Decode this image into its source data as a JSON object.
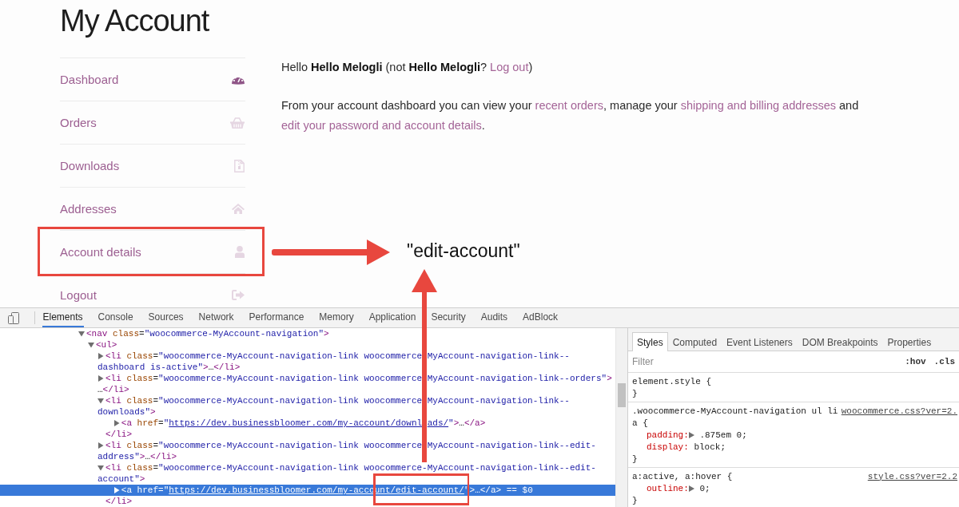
{
  "page": {
    "title": "My Account"
  },
  "nav": [
    {
      "label": "Dashboard",
      "selected": true
    },
    {
      "label": "Orders",
      "selected": false
    },
    {
      "label": "Downloads",
      "selected": false
    },
    {
      "label": "Addresses",
      "selected": false
    },
    {
      "label": "Account details",
      "selected": false
    },
    {
      "label": "Logout",
      "selected": false
    }
  ],
  "greeting": [
    {
      "kind": "text",
      "text": "Hello **Hello Melogli** (not **Hello Melogli**? "
    },
    {
      "kind": "link",
      "text": "Log out"
    },
    {
      "kind": "text",
      "text": ")"
    }
  ],
  "intro": [
    {
      "kind": "text",
      "text": "From your account dashboard you can view your "
    },
    {
      "kind": "link",
      "text": "recent orders"
    },
    {
      "kind": "text",
      "text": ", manage your "
    },
    {
      "kind": "link",
      "text": "shipping and billing addresses"
    },
    {
      "kind": "text",
      "text": " and "
    },
    {
      "kind": "link",
      "text": "edit your password and account details"
    },
    {
      "kind": "text",
      "text": "."
    }
  ],
  "annotation": {
    "label": "\"edit-account\""
  },
  "devtools": {
    "tabs": [
      {
        "label": "Elements",
        "selected": true
      },
      {
        "label": "Console",
        "selected": false
      },
      {
        "label": "Sources",
        "selected": false
      },
      {
        "label": "Network",
        "selected": false
      },
      {
        "label": "Performance",
        "selected": false
      },
      {
        "label": "Memory",
        "selected": false
      },
      {
        "label": "Application",
        "selected": false
      },
      {
        "label": "Security",
        "selected": false
      },
      {
        "label": "Audits",
        "selected": false
      },
      {
        "label": "AdBlock",
        "selected": false
      }
    ],
    "dom": {
      "expanded": true,
      "selected": false,
      "lines": [
        [
          {
            "kind": "tag",
            "text": "<nav"
          },
          {
            "kind": "attr",
            "text": " class"
          },
          {
            "kind": "text",
            "text": "="
          },
          {
            "kind": "value",
            "text": "\"woocommerce-MyAccount-navigation\""
          },
          {
            "kind": "tag",
            "text": ">"
          }
        ]
      ],
      "children": [
        {
          "expanded": true,
          "selected": false,
          "lines": [
            [
              {
                "kind": "tag",
                "text": "<ul>"
              }
            ]
          ],
          "children": [
            {
              "expanded": false,
              "selected": false,
              "lines": [
                [
                  {
                    "kind": "tag",
                    "text": "<li"
                  },
                  {
                    "kind": "attr",
                    "text": " class"
                  },
                  {
                    "kind": "text",
                    "text": "="
                  },
                  {
                    "kind": "value",
                    "text": "\"woocommerce-MyAccount-navigation-link woocommerce"
                  },
                  {
                    "kind": "covered"
                  },
                  {
                    "kind": "value",
                    "text": "MyAccount-navigation-link--"
                  }
                ],
                [
                  {
                    "kind": "value",
                    "text": "dashboard is-active\""
                  },
                  {
                    "kind": "tag",
                    "text": ">"
                  },
                  {
                    "kind": "text",
                    "text": "…"
                  },
                  {
                    "kind": "tag",
                    "text": "</li>"
                  }
                ]
              ]
            },
            {
              "expanded": false,
              "selected": false,
              "lines": [
                [
                  {
                    "kind": "tag",
                    "text": "<li"
                  },
                  {
                    "kind": "attr",
                    "text": " class"
                  },
                  {
                    "kind": "text",
                    "text": "="
                  },
                  {
                    "kind": "value",
                    "text": "\"woocommerce-MyAccount-navigation-link woocommerce"
                  },
                  {
                    "kind": "covered"
                  },
                  {
                    "kind": "value",
                    "text": "MyAccount-navigation-link--orders\""
                  },
                  {
                    "kind": "tag",
                    "text": ">"
                  }
                ],
                [
                  {
                    "kind": "text",
                    "text": "…"
                  },
                  {
                    "kind": "tag",
                    "text": "</li>"
                  }
                ]
              ]
            },
            {
              "expanded": true,
              "selected": false,
              "lines": [
                [
                  {
                    "kind": "tag",
                    "text": "<li"
                  },
                  {
                    "kind": "attr",
                    "text": " class"
                  },
                  {
                    "kind": "text",
                    "text": "="
                  },
                  {
                    "kind": "value",
                    "text": "\"woocommerce-MyAccount-navigation-link woocommerce"
                  },
                  {
                    "kind": "covered"
                  },
                  {
                    "kind": "value",
                    "text": "MyAccount-navigation-link--"
                  }
                ],
                [
                  {
                    "kind": "value",
                    "text": "downloads\""
                  },
                  {
                    "kind": "tag",
                    "text": ">"
                  }
                ]
              ],
              "children": [
                {
                  "expanded": false,
                  "selected": false,
                  "lines": [
                    [
                      {
                        "kind": "tag",
                        "text": "<a"
                      },
                      {
                        "kind": "attr",
                        "text": " href"
                      },
                      {
                        "kind": "text",
                        "text": "="
                      },
                      {
                        "kind": "value",
                        "text": "\""
                      },
                      {
                        "kind": "link",
                        "pieces": [
                          "https://dev.businessbloomer.com/my-account/downl",
                          "ads/"
                        ]
                      },
                      {
                        "kind": "value",
                        "text": "\""
                      },
                      {
                        "kind": "tag",
                        "text": ">"
                      },
                      {
                        "kind": "text",
                        "text": "…"
                      },
                      {
                        "kind": "tag",
                        "text": "</a>"
                      }
                    ]
                  ]
                }
              ],
              "close": [
                {
                  "kind": "tag",
                  "text": "</li>"
                }
              ]
            },
            {
              "expanded": false,
              "selected": false,
              "lines": [
                [
                  {
                    "kind": "tag",
                    "text": "<li"
                  },
                  {
                    "kind": "attr",
                    "text": " class"
                  },
                  {
                    "kind": "text",
                    "text": "="
                  },
                  {
                    "kind": "value",
                    "text": "\"woocommerce-MyAccount-navigation-link woocommerce"
                  },
                  {
                    "kind": "covered"
                  },
                  {
                    "kind": "value",
                    "text": "MyAccount-navigation-link--edit-"
                  }
                ],
                [
                  {
                    "kind": "value",
                    "text": "address\""
                  },
                  {
                    "kind": "tag",
                    "text": ">"
                  },
                  {
                    "kind": "text",
                    "text": "…"
                  },
                  {
                    "kind": "tag",
                    "text": "</li>"
                  }
                ]
              ]
            },
            {
              "expanded": true,
              "selected": false,
              "lines": [
                [
                  {
                    "kind": "tag",
                    "text": "<li"
                  },
                  {
                    "kind": "attr",
                    "text": " class"
                  },
                  {
                    "kind": "text",
                    "text": "="
                  },
                  {
                    "kind": "value",
                    "text": "\"woocommerce-MyAccount-navigation-link woocommerce-MyAccount-navigation-link--edit-"
                  }
                ],
                [
                  {
                    "kind": "value",
                    "text": "account\""
                  },
                  {
                    "kind": "tag",
                    "text": ">"
                  }
                ]
              ],
              "children": [
                {
                  "expanded": false,
                  "selected": true,
                  "lines": [
                    [
                      {
                        "kind": "tag",
                        "text": "<a"
                      },
                      {
                        "kind": "attr",
                        "text": " href"
                      },
                      {
                        "kind": "text",
                        "text": "="
                      },
                      {
                        "kind": "value",
                        "text": "\""
                      },
                      {
                        "kind": "link",
                        "text": "https://dev.businessbloomer.com/my-account/edit-account/"
                      },
                      {
                        "kind": "value",
                        "text": "\""
                      },
                      {
                        "kind": "tag",
                        "text": ">"
                      },
                      {
                        "kind": "text",
                        "text": "…"
                      },
                      {
                        "kind": "tag",
                        "text": "</a>"
                      },
                      {
                        "kind": "note",
                        "text": " == $0"
                      }
                    ]
                  ]
                }
              ],
              "close": [
                {
                  "kind": "tag",
                  "text": "</li>"
                }
              ]
            }
          ]
        }
      ]
    },
    "sidebar_tabs": [
      {
        "label": "Styles",
        "selected": true
      },
      {
        "label": "Computed",
        "selected": false
      },
      {
        "label": "Event Listeners",
        "selected": false
      },
      {
        "label": "DOM Breakpoints",
        "selected": false
      },
      {
        "label": "Properties",
        "selected": false
      }
    ],
    "filter": {
      "placeholder": "Filter"
    },
    "toggles": [
      ":hov",
      ".cls"
    ],
    "rules": [
      {
        "selector": [
          "element.style {"
        ],
        "close": "}"
      },
      {
        "selector": [
          ".woocommerce-MyAccount-navigation ul li",
          "a {"
        ],
        "source": "woocommerce.css?ver=2.",
        "declarations": [
          {
            "name": "padding:",
            "expandable": true,
            "value": " .875em 0;"
          },
          {
            "name": "display:",
            "expandable": false,
            "value": " block;"
          }
        ],
        "close": "}"
      },
      {
        "selector": [
          "a:active, a:hover {"
        ],
        "source": "style.css?ver=2.2",
        "declarations": [
          {
            "name": "outline:",
            "expandable": true,
            "value": " 0;"
          }
        ],
        "close": "}"
      }
    ]
  }
}
